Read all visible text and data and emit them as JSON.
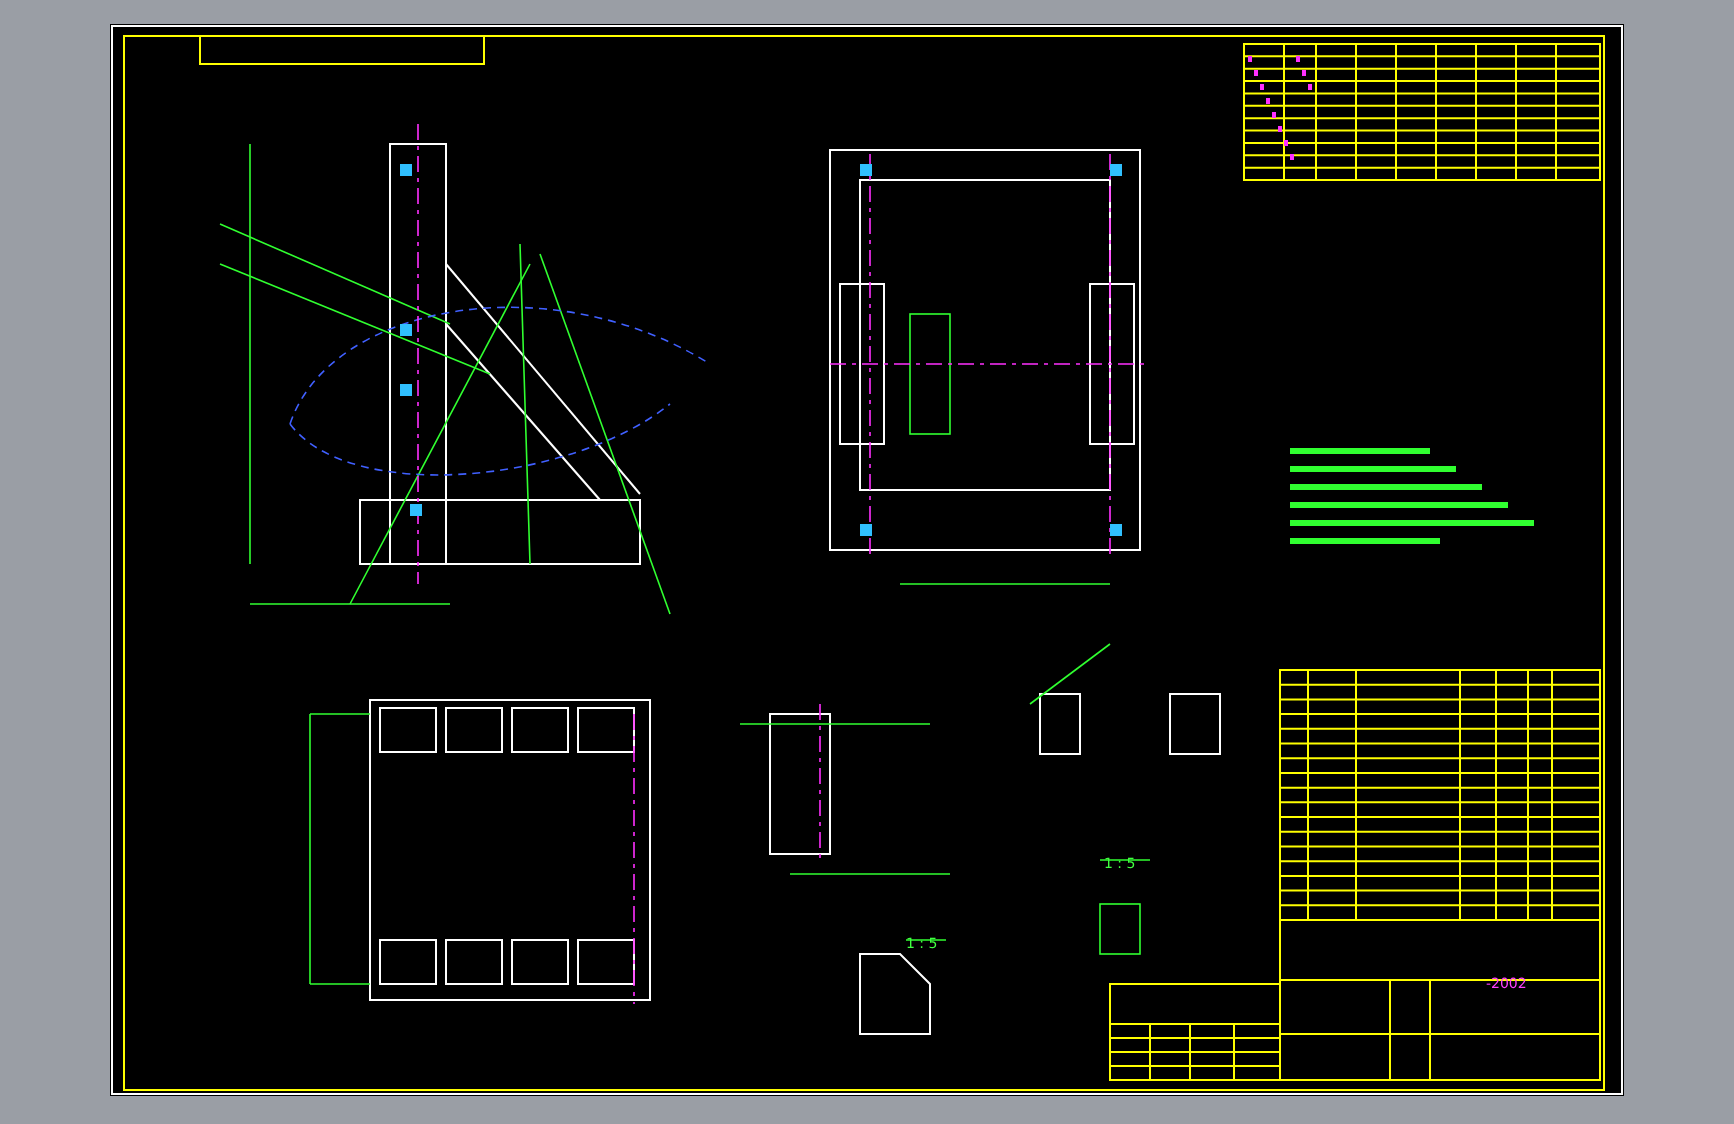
{
  "drawing": {
    "labels": [
      {
        "kind": "scale",
        "text": "1 : 5",
        "color": "#40ff40"
      },
      {
        "kind": "scale",
        "text": "1 : 5",
        "color": "#40ff40"
      },
      {
        "kind": "year",
        "text": "-2002",
        "color": "#ff40ff"
      }
    ]
  }
}
